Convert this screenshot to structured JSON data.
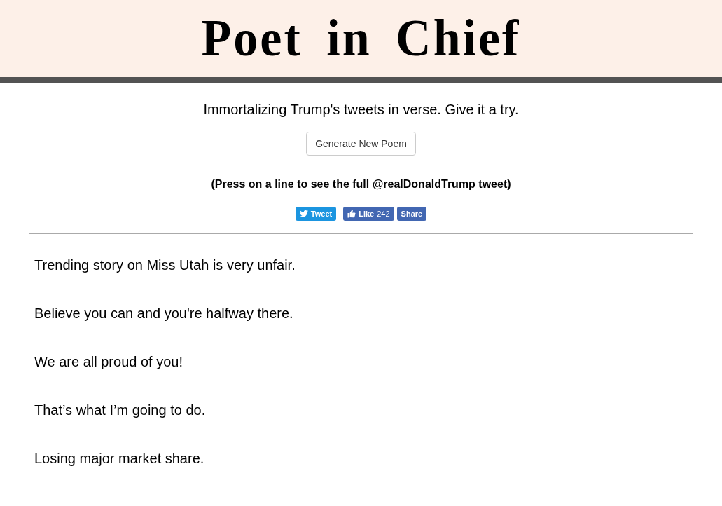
{
  "header": {
    "title": "Poet in Chief"
  },
  "intro": {
    "tagline": "Immortalizing Trump's tweets in verse. Give it a try.",
    "button": "Generate New Poem",
    "hint": "(Press on a line to see the full @realDonaldTrump tweet)"
  },
  "share": [
    {
      "kind": "tweet",
      "label": "Tweet"
    },
    {
      "kind": "like",
      "label": "Like",
      "count": "242"
    },
    {
      "kind": "share",
      "label": "Share"
    }
  ],
  "poem": [
    "Trending story on Miss Utah is very unfair.",
    "Believe you can and you're halfway there.",
    "We are all proud of you!",
    "That’s what I’m going to do.",
    "Losing major market share."
  ]
}
